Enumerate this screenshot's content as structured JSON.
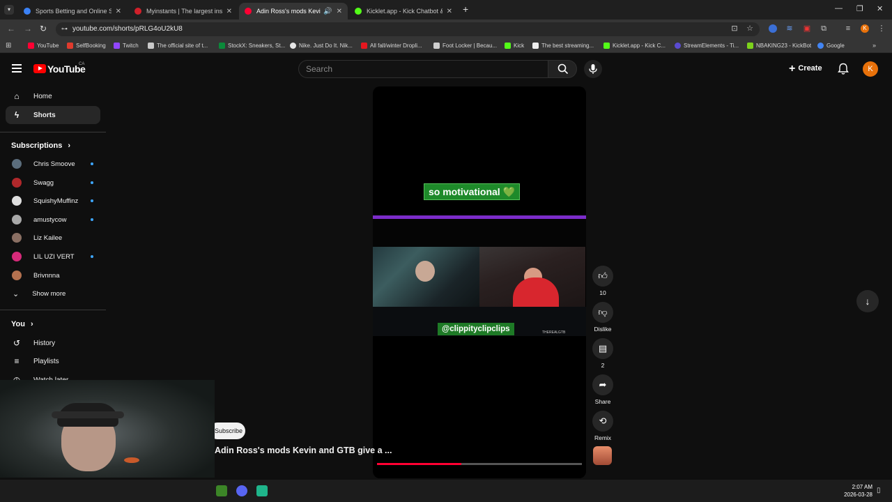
{
  "browser": {
    "tabs": [
      {
        "title": "Sports Betting and Online Spor",
        "color": "#3b82f6"
      },
      {
        "title": "Myinstants | The largest instant",
        "color": "#d1202a"
      },
      {
        "title": "Adin Ross's mods Kevin and",
        "color": "#ff0033"
      },
      {
        "title": "Kicklet.app - Kick Chatbot &",
        "color": "#53fc18"
      }
    ],
    "new_tab": "+",
    "url": "youtube.com/shorts/pRLG4oU2kU8",
    "bookmarks": [
      {
        "label": "YouTube",
        "color": "#ff0033"
      },
      {
        "label": "SelfBooking",
        "color": "#e03b2d"
      },
      {
        "label": "Twitch",
        "color": "#9146ff"
      },
      {
        "label": "The official site of t...",
        "color": "#c9c9c9"
      },
      {
        "label": "StockX: Sneakers, St...",
        "color": "#0b8a3a"
      },
      {
        "label": "Nike. Just Do It. Nik...",
        "color": "#e6e6e6"
      },
      {
        "label": "All fall/winter Dropli...",
        "color": "#e5171f"
      },
      {
        "label": "Foot Locker | Becau...",
        "color": "#cfcfcf"
      },
      {
        "label": "Kick",
        "color": "#53fc18"
      },
      {
        "label": "The best streaming...",
        "color": "#eeeeee"
      },
      {
        "label": "Kicklet.app - Kick C...",
        "color": "#53fc18"
      },
      {
        "label": "StreamElements - Ti...",
        "color": "#5a4bd1"
      },
      {
        "label": "NBAKING23 - KickBot",
        "color": "#7cd31b"
      },
      {
        "label": "Google",
        "color": "#4285f4"
      }
    ]
  },
  "header": {
    "logo": "YouTube",
    "region": "CA",
    "search_placeholder": "Search",
    "create_label": "Create",
    "avatar_letter": "K"
  },
  "sidebar": {
    "items": [
      {
        "label": "Home",
        "icon": "home-icon"
      },
      {
        "label": "Shorts",
        "icon": "shorts-icon"
      }
    ],
    "subscriptions_label": "Subscriptions",
    "subscriptions": [
      {
        "name": "Chris Smoove",
        "color": "#5b6d7c",
        "new": true
      },
      {
        "name": "Swagg",
        "color": "#b0282b",
        "new": true
      },
      {
        "name": "SquishyMuffinz",
        "color": "#dedede",
        "new": true
      },
      {
        "name": "amustycow",
        "color": "#a8a8a8",
        "new": true
      },
      {
        "name": "Liz Kailee",
        "color": "#8a6f63",
        "new": false
      },
      {
        "name": "LIL UZI VERT",
        "color": "#d62a7a",
        "new": true
      },
      {
        "name": "Brivnnna",
        "color": "#b4714f",
        "new": false
      }
    ],
    "show_more": "Show more",
    "you_label": "You",
    "you_items": [
      {
        "label": "History",
        "icon": "history-icon"
      },
      {
        "label": "Playlists",
        "icon": "playlists-icon"
      },
      {
        "label": "Watch later",
        "icon": "clock-icon"
      }
    ]
  },
  "short": {
    "caption_top": "so motivational 💚",
    "caption_bottom": "@clippityclipclips",
    "overlay_tag": "THEREALGTB",
    "progress": 0.41,
    "subscribe_label": "Subscribe",
    "title": "Adin Ross's mods Kevin and GTB give a ..."
  },
  "actions": {
    "like_count": "10",
    "dislike_label": "Dislike",
    "comment_count": "2",
    "share_label": "Share",
    "remix_label": "Remix"
  },
  "taskbar": {
    "time": "2:07 AM",
    "date": "2026-03-28"
  }
}
